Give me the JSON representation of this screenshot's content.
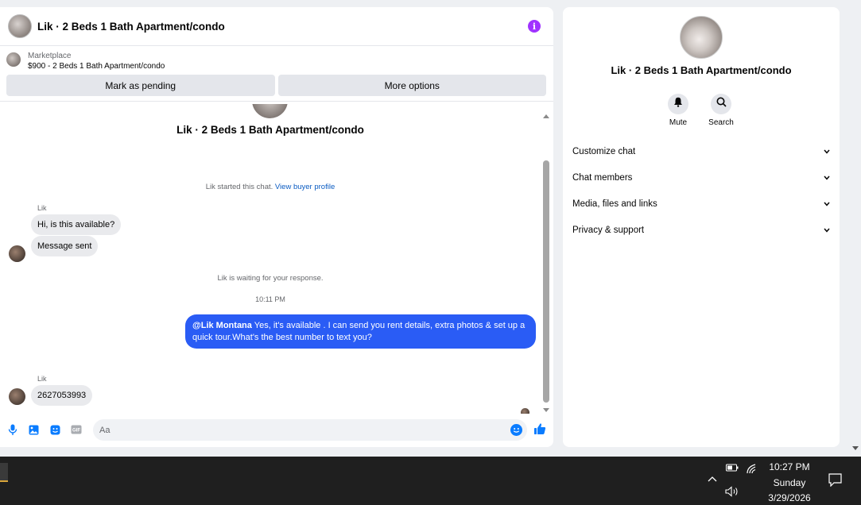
{
  "chat": {
    "title": "Lik · 2 Beds 1 Bath Apartment/condo",
    "marketplace_label": "Marketplace",
    "listing": "$900 - 2 Beds 1 Bath Apartment/condo",
    "mark_pending": "Mark as pending",
    "more_options": "More options",
    "conversation_title": "Lik · 2 Beds 1 Bath Apartment/condo",
    "started_text": "Lik started this chat.",
    "view_buyer_profile": "View buyer profile",
    "messages": [
      {
        "sender": "Lik",
        "text": "Hi, is this available?"
      },
      {
        "text": "Message sent"
      }
    ],
    "waiting_text": "Lik is waiting for your response.",
    "timestamp": "10:11 PM",
    "outgoing": {
      "mention": "@Lik Montana",
      "text": " Yes, it's available .  I can send you rent details, extra photos & set up a quick tour.What's the best number to text you?"
    },
    "reply": {
      "sender": "Lik",
      "text": "2627053993"
    },
    "input_placeholder": "Aa"
  },
  "info": {
    "title": "Lik · 2 Beds 1 Bath Apartment/condo",
    "mute": "Mute",
    "search": "Search",
    "sections": [
      "Customize chat",
      "Chat members",
      "Media, files and links",
      "Privacy & support"
    ]
  },
  "taskbar": {
    "time": "10:27 PM",
    "day": "Sunday",
    "date": "3/29/2026"
  },
  "colors": {
    "accent": "#2a5cf5",
    "info_icon": "#a033ff",
    "link": "#0a5bc2",
    "composer_icons": "#0a7cff"
  }
}
